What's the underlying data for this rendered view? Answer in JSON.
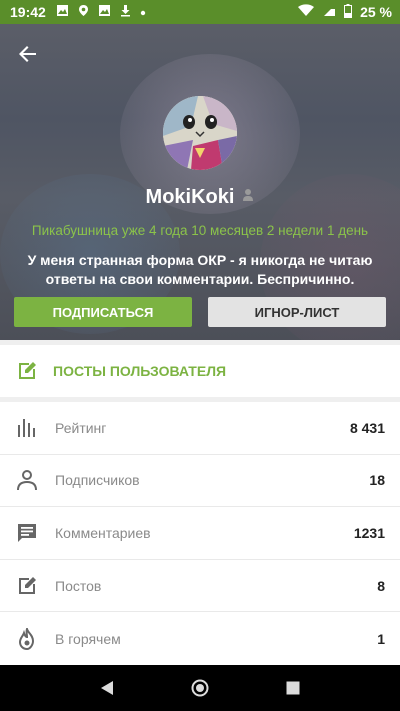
{
  "status_bar": {
    "time": "19:42",
    "battery": "25 %",
    "icons": [
      "image-icon",
      "location-icon",
      "image-icon",
      "download-icon",
      "dot-icon"
    ],
    "right_icons": [
      "wifi-icon",
      "signal-icon",
      "battery-icon"
    ]
  },
  "profile": {
    "username": "MokiKoki",
    "tenure": "Пикабушница уже 4 года 10 месяцев 2 недели 1 день",
    "bio": "У меня странная форма ОКР - я никогда не читаю ответы на свои комментарии. Беспричинно.",
    "subscribe_label": "ПОДПИСАТЬСЯ",
    "ignore_label": "ИГНОР-ЛИСТ"
  },
  "posts_link": {
    "label": "ПОСТЫ ПОЛЬЗОВАТЕЛЯ"
  },
  "stats": [
    {
      "icon": "bar-chart-icon",
      "label": "Рейтинг",
      "value": "8 431"
    },
    {
      "icon": "person-icon",
      "label": "Подписчиков",
      "value": "18"
    },
    {
      "icon": "comment-icon",
      "label": "Комментариев",
      "value": "1231"
    },
    {
      "icon": "edit-icon",
      "label": "Постов",
      "value": "8"
    },
    {
      "icon": "fire-icon",
      "label": "В горячем",
      "value": "1"
    }
  ],
  "colors": {
    "accent": "#7cb342",
    "status_bar": "#5a8e2a"
  }
}
